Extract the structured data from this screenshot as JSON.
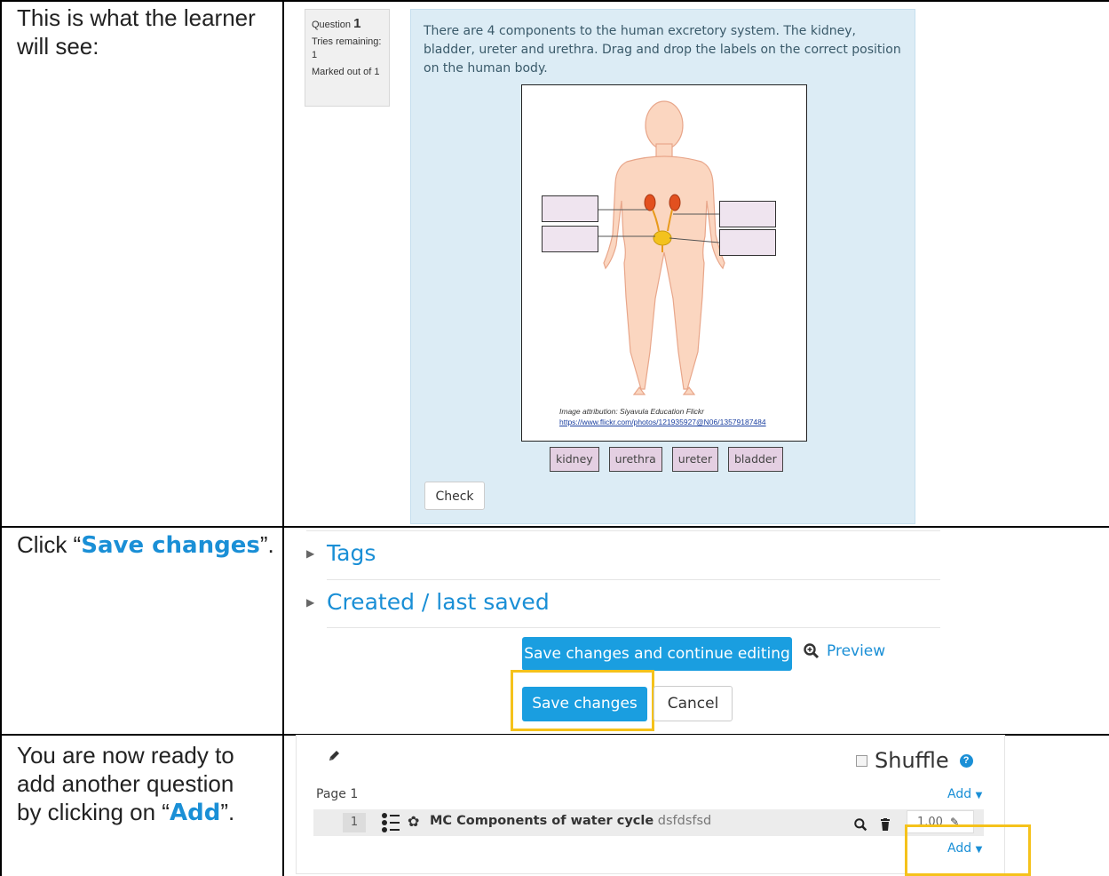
{
  "rows": [
    {
      "instruction": "This is what the learner will see:"
    },
    {
      "instruction_pre": "Click “",
      "instruction_hl": "Save changes",
      "instruction_post": "”."
    },
    {
      "instruction_pre": "You are now ready to add another question by clicking on “",
      "instruction_hl": "Add",
      "instruction_post": "”."
    }
  ],
  "question": {
    "label": "Question",
    "number": "1",
    "tries": "Tries remaining: 1",
    "marked": "Marked out of 1",
    "text": "There are 4 components to the human excretory system. The kidney, bladder, ureter and urethra. Drag and drop the labels on the correct position on the human body.",
    "attribution": "Image attribution: Siyavula Education Flickr",
    "attribution_url": "https://www.flickr.com/photos/121935927@N06/13579187484",
    "choices": [
      "kidney",
      "urethra",
      "ureter",
      "bladder"
    ],
    "check_label": "Check"
  },
  "form": {
    "tags_label": "Tags",
    "created_label": "Created / last saved",
    "save_continue_label": "Save changes and continue editing",
    "preview_label": "Preview",
    "save_label": "Save changes",
    "cancel_label": "Cancel"
  },
  "quiz": {
    "shuffle_label": "Shuffle",
    "page_label": "Page 1",
    "add_label": "Add",
    "slot_number": "1",
    "question_title": "MC Components of water cycle",
    "question_text": "dsfdsfsd",
    "mark": "1.00"
  },
  "colors": {
    "accent": "#1a8fd6",
    "highlight": "#f5c21b",
    "panel": "#dcecf5"
  }
}
